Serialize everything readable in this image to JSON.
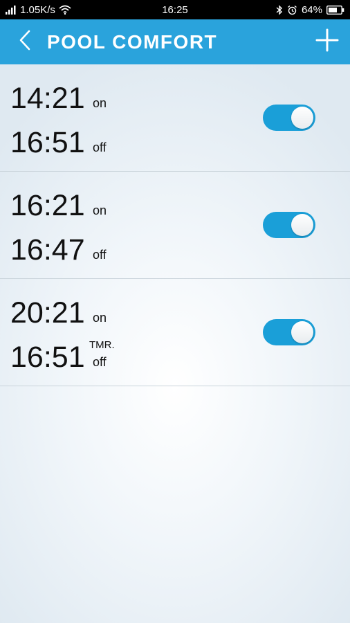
{
  "status_bar": {
    "net_speed": "1.05K/s",
    "time": "16:25",
    "battery": "64%"
  },
  "header": {
    "title": "POOL COMFORT"
  },
  "icons": {
    "back": "chevron-left-icon",
    "add": "plus-icon",
    "signal": "signal-icon",
    "wifi": "wifi-icon",
    "bluetooth": "bluetooth-icon",
    "alarm": "alarm-icon",
    "battery": "battery-icon"
  },
  "colors": {
    "accent": "#2aa3dc",
    "toggle_on": "#1a9fd8"
  },
  "schedules": [
    {
      "on_time": "14:21",
      "on_label": "on",
      "off_time": "16:51",
      "off_label": "off",
      "tmr": "",
      "enabled": true
    },
    {
      "on_time": "16:21",
      "on_label": "on",
      "off_time": "16:47",
      "off_label": "off",
      "tmr": "",
      "enabled": true
    },
    {
      "on_time": "20:21",
      "on_label": "on",
      "off_time": "16:51",
      "off_label": "off",
      "tmr": "TMR.",
      "enabled": true
    }
  ]
}
